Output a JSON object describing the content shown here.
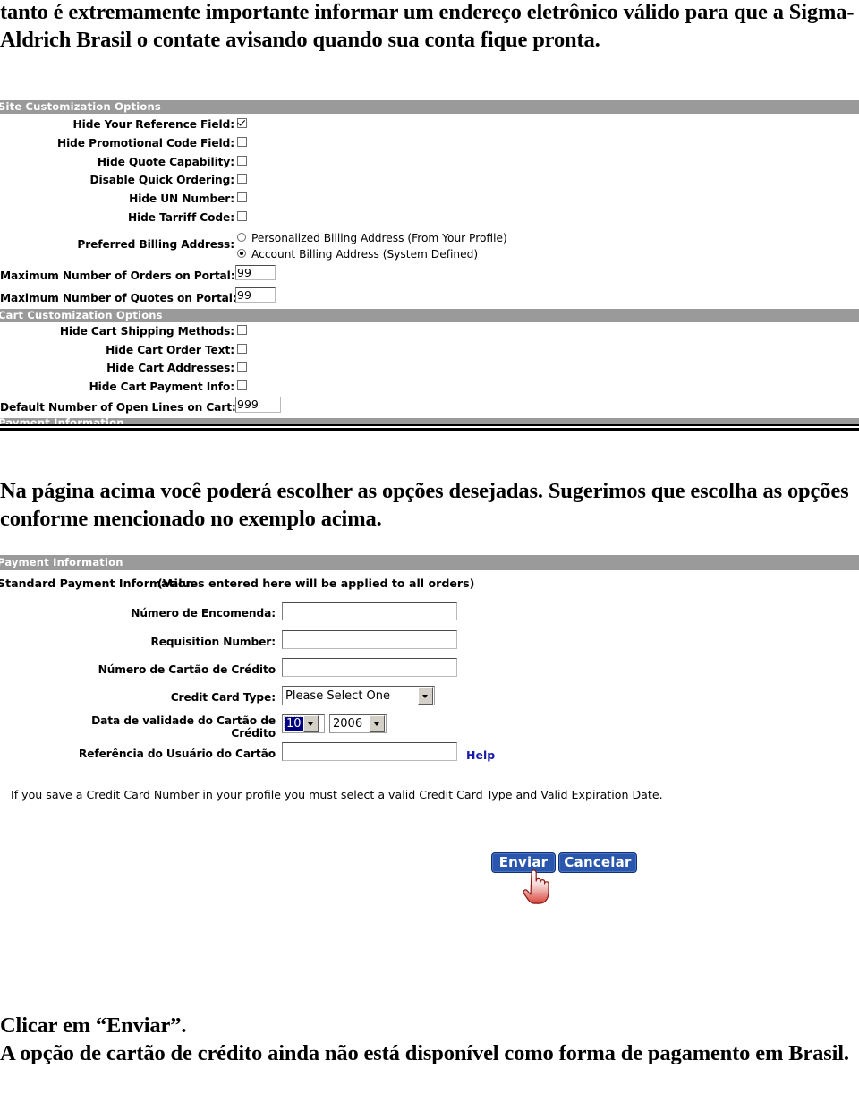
{
  "document": {
    "intro_paragraph": "tanto é extremamente importante informar um endereço eletrônico válido para que a Sigma-Aldrich Brasil o contate avisando quando sua conta fique pronta.",
    "middle_paragraph": "Na página acima você poderá escolher as opções desejadas. Sugerimos que escolha as opções conforme mencionado no exemplo acima.",
    "closing_click": "Clicar em “Enviar”.",
    "closing_note": "A opção de cartão de crédito ainda não está disponível como forma de pagamento em Brasil."
  },
  "colors": {
    "section_bar": "#9a9a9a",
    "button_blue": "#2a56ad",
    "help_link": "#1a1aa8",
    "select_highlight": "#000080"
  },
  "site_options": {
    "section_title": "Site Customization Options",
    "checkboxes": [
      {
        "label": "Hide Your Reference Field:",
        "checked": true
      },
      {
        "label": "Hide Promotional Code Field:",
        "checked": false
      },
      {
        "label": "Hide Quote Capability:",
        "checked": false
      },
      {
        "label": "Disable Quick Ordering:",
        "checked": false
      },
      {
        "label": "Hide UN Number:",
        "checked": false
      },
      {
        "label": "Hide Tarriff Code:",
        "checked": false
      }
    ],
    "billing": {
      "label": "Preferred Billing Address:",
      "options": [
        {
          "label": "Personalized Billing Address (From Your Profile)",
          "selected": false
        },
        {
          "label": "Account Billing Address (System Defined)",
          "selected": true
        }
      ]
    },
    "numeric_fields": [
      {
        "label": "Maximum Number of Orders on Portal:",
        "value": "99"
      },
      {
        "label": "Maximum Number of Quotes on Portal:",
        "value": "99"
      }
    ]
  },
  "cart_options": {
    "section_title": "Cart Customization Options",
    "checkboxes": [
      {
        "label": "Hide Cart Shipping Methods:",
        "checked": false
      },
      {
        "label": "Hide Cart Order Text:",
        "checked": false
      },
      {
        "label": "Hide Cart Addresses:",
        "checked": false
      },
      {
        "label": "Hide Cart Payment Info:",
        "checked": false
      }
    ],
    "numeric_field": {
      "label": "Default Number of Open Lines on Cart:",
      "value": "999"
    },
    "clipped_next_section": "Payment Information"
  },
  "payment": {
    "section_title": "Payment Information",
    "subtitle_bold": "Standard Payment Information",
    "subtitle_note": "(Values entered here will be applied to all orders)",
    "fields": [
      {
        "label": "Número de Encomenda:",
        "value": "",
        "type": "text"
      },
      {
        "label": "Requisition Number:",
        "value": "",
        "type": "text"
      },
      {
        "label": "Número de Cartão de Crédito",
        "value": "",
        "type": "text"
      }
    ],
    "card_type": {
      "label": "Credit Card Type:",
      "value": "Please Select One"
    },
    "expiration": {
      "label": "Data de validade do Cartão de Crédito",
      "month": "10",
      "year": "2006"
    },
    "card_user_ref": {
      "label": "Referência do Usuário do Cartão",
      "value": ""
    },
    "help_label": "Help",
    "disclaimer": "If you save a Credit Card Number in your profile you must select a valid Credit Card Type and Valid Expiration Date.",
    "buttons": {
      "submit": "Enviar",
      "cancel": "Cancelar"
    }
  }
}
